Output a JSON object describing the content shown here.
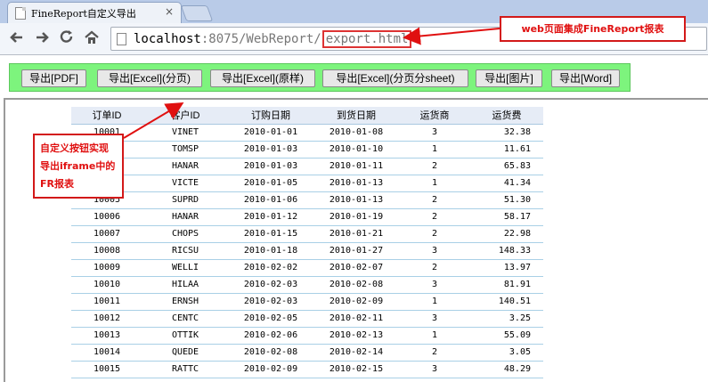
{
  "browser": {
    "tab_title": "FineReport自定义导出",
    "tab_close": "×",
    "url_host": "localhost",
    "url_rest": ":8075/WebReport/",
    "url_file": "export.html"
  },
  "export_buttons": [
    "导出[PDF]",
    "导出[Excel](分页)",
    "导出[Excel](原样)",
    "导出[Excel](分页分sheet)",
    "导出[图片]",
    "导出[Word]"
  ],
  "annotations": {
    "top": "web页面集成FineReport报表",
    "left": "自定义按钮实现导出iframe中的FR报表"
  },
  "table": {
    "headers": [
      "订单ID",
      "客户ID",
      "订购日期",
      "到货日期",
      "运货商",
      "运货费"
    ],
    "rows": [
      [
        "10001",
        "VINET",
        "2010-01-01",
        "2010-01-08",
        "3",
        "32.38"
      ],
      [
        "10002",
        "TOMSP",
        "2010-01-03",
        "2010-01-10",
        "1",
        "11.61"
      ],
      [
        "10003",
        "HANAR",
        "2010-01-03",
        "2010-01-11",
        "2",
        "65.83"
      ],
      [
        "10004",
        "VICTE",
        "2010-01-05",
        "2010-01-13",
        "1",
        "41.34"
      ],
      [
        "10005",
        "SUPRD",
        "2010-01-06",
        "2010-01-13",
        "2",
        "51.30"
      ],
      [
        "10006",
        "HANAR",
        "2010-01-12",
        "2010-01-19",
        "2",
        "58.17"
      ],
      [
        "10007",
        "CHOPS",
        "2010-01-15",
        "2010-01-21",
        "2",
        "22.98"
      ],
      [
        "10008",
        "RICSU",
        "2010-01-18",
        "2010-01-27",
        "3",
        "148.33"
      ],
      [
        "10009",
        "WELLI",
        "2010-02-02",
        "2010-02-07",
        "2",
        "13.97"
      ],
      [
        "10010",
        "HILAA",
        "2010-02-03",
        "2010-02-08",
        "3",
        "81.91"
      ],
      [
        "10011",
        "ERNSH",
        "2010-02-03",
        "2010-02-09",
        "1",
        "140.51"
      ],
      [
        "10012",
        "CENTC",
        "2010-02-05",
        "2010-02-11",
        "3",
        "3.25"
      ],
      [
        "10013",
        "OTTIK",
        "2010-02-06",
        "2010-02-13",
        "1",
        "55.09"
      ],
      [
        "10014",
        "QUEDE",
        "2010-02-08",
        "2010-02-14",
        "2",
        "3.05"
      ],
      [
        "10015",
        "RATTC",
        "2010-02-09",
        "2010-02-15",
        "3",
        "48.29"
      ]
    ]
  },
  "colors": {
    "button_bar": "#7df47d",
    "annotation": "#e01010"
  }
}
